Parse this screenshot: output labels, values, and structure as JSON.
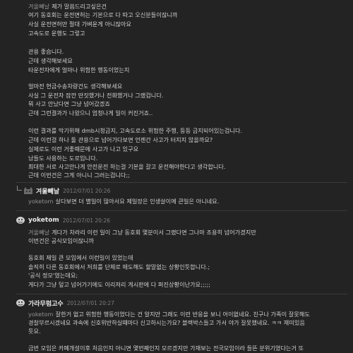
{
  "comments": [
    {
      "lines": [
        {
          "nick": "겨울빼날",
          "text": "제가 말씀드리고싶은건"
        },
        {
          "text": "여기 동호회는 운전면허는 기본으로 다 따고 오신분들이잖니까"
        },
        {
          "text": "사실 운전면허만 절대 가벼운게 아니잖아요"
        },
        {
          "text": "고속도로 운행도 그렇고"
        },
        {
          "text": ""
        },
        {
          "text": "관용 좋습니다."
        },
        {
          "text": "근데 생각해보세요"
        },
        {
          "text": "타운전자에게 얼마나 위험한 행동이었는지"
        },
        {
          "text": ""
        },
        {
          "text": "얼마전 현금수송차량건도 생각해보세요"
        },
        {
          "text": "사실 그 운전자 잠깐 딴짓했거나 전화했거나 그랬겁니다."
        },
        {
          "text": "뭐 사고 안났다면 그냥 넘어갔겠죠"
        },
        {
          "text": "근데 그런결과가 나왔으니 엄청나게 일이 커진거죠.."
        },
        {
          "text": ""
        },
        {
          "text": "이런 결과를 막기위해 dmb시청금지, 고속도로소 위험한 주행, 등등 금지되어있는겁니다."
        },
        {
          "text": "근데 이런걸 하나 둘 관용으로 넘어가다보면 언젠간 사고가 터지지 않을까요?"
        },
        {
          "text": "실제로도 이런 거좋때문에 사고가 나고 있구요"
        },
        {
          "text": "남들도 사용하는 도로입니다."
        },
        {
          "text": "최대한 서로 사고안나게 안전운전 하는걸 기본을 갈고 운전해야한다고 생각합니다."
        },
        {
          "text": "근데 이번건은 그게 아니니 그러는겁니다;;"
        }
      ]
    },
    {
      "author": "겨울빼날",
      "date": "2012/07/01 20:26",
      "lines": [
        {
          "nick": "yoketom",
          "text": "살다보면 더 별일이 많아서요 제일장은 인생살이에 큰일은 아니네요."
        }
      ]
    },
    {
      "author": "yoketom",
      "date": "2012/07/01 20:26",
      "lines": [
        {
          "nick": "겨울빼날",
          "text": "게다가 차라리 이런 일이 그냥 동호회 몇분이서 그랬다면 그나마 조용히 넘어가겠지만"
        },
        {
          "text": "이번건은 공식모임이잖니까"
        },
        {
          "text": ""
        },
        {
          "text": "동호회 제일 큰 모임에서 이런일이 있었는데"
        },
        {
          "text": "솔직히 다른 동호회에서 저희를 단체로 매도해도 할말없는 상황인듯합니다.;"
        },
        {
          "text": "'공식 정모'였는데요;"
        },
        {
          "text": "게다가 그냥 덮고 넘어가기에도 이리저리 게시판에 다 퍼진상황이난가요;;;;;"
        }
      ]
    },
    {
      "author": "가라무럼고수",
      "date": "2012/07/01 20:27",
      "lines": [
        {
          "nick": "yoketom",
          "text": "잘한거 없고 위험한 행동이었다는 건 알지만 그래도 이런 반응을 보니 어이없네요. 친구나 가족이 잘못해도"
        },
        {
          "text": "경찰부르시겠네요 과속에 신호위반하실때마다 신고하시는가요? 블랙박스들고 가서 야가 잘못했네요. ㅋㅋ 재미있음"
        },
        {
          "text": "듯요."
        },
        {
          "text": ""
        },
        {
          "text": "금번 모임은 카페개설이후 처음인지 아니면 몇번째인지 모르겠지만 가재보는 전국모임이라 들뜬 분위기였다는거 또"
        }
      ]
    }
  ],
  "colors": {
    "background": "#232323",
    "text": "#cfcfcf",
    "muted": "#7d7d7d",
    "author": "#e8e8e8",
    "separator": "#3a3a3a"
  }
}
